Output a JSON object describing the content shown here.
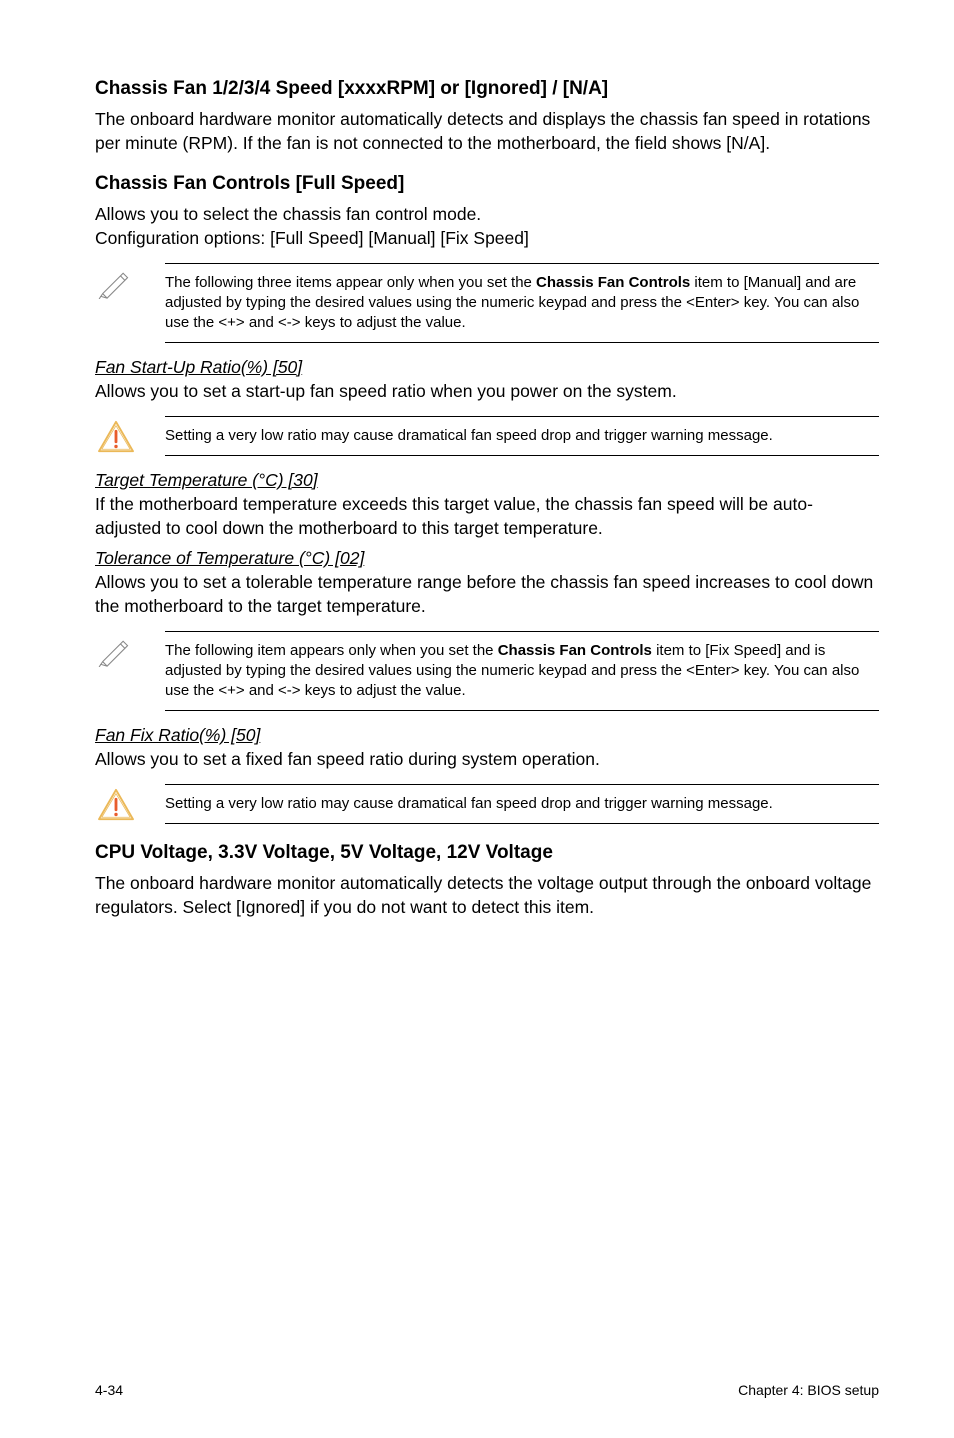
{
  "section1": {
    "heading": "Chassis Fan 1/2/3/4 Speed [xxxxRPM] or [Ignored] / [N/A]",
    "body": "The onboard hardware monitor automatically detects and displays the chassis fan speed in rotations per minute (RPM). If the fan is not connected to the motherboard, the field shows [N/A]."
  },
  "section2": {
    "heading": "Chassis Fan Controls [Full Speed]",
    "body_line1": "Allows you to select the chassis fan control mode.",
    "body_line2": "Configuration options: [Full Speed] [Manual] [Fix Speed]"
  },
  "callout1": {
    "prefix": "The following three items appear only when you set the ",
    "bold": "Chassis Fan Controls",
    "suffix": " item to [Manual] and are adjusted by typing the desired values using the numeric keypad and press the <Enter> key. You can also use the <+> and <-> keys to adjust the value."
  },
  "sub1": {
    "heading": "Fan Start-Up Ratio(%) [50]",
    "body": "Allows you to set a start-up fan speed ratio when you power on the system."
  },
  "callout2": {
    "text": "Setting a very low ratio may cause dramatical fan speed drop and trigger warning message."
  },
  "sub2": {
    "heading": "Target Temperature (°C) [30]",
    "body": "If the motherboard temperature exceeds this target value, the chassis fan speed will be auto-adjusted to cool down the motherboard to this target temperature."
  },
  "sub3": {
    "heading": "Tolerance of Temperature (°C) [02]",
    "body": "Allows you to set a tolerable temperature range before the chassis fan speed increases to cool down the motherboard to the target temperature."
  },
  "callout3": {
    "prefix": "The following item appears only when you set the ",
    "bold": "Chassis Fan Controls",
    "suffix": " item to [Fix Speed] and is adjusted by typing the desired values using the numeric keypad and press the <Enter> key. You can also use the <+> and <-> keys to adjust the value."
  },
  "sub4": {
    "heading": "Fan Fix Ratio(%) [50]",
    "body": "Allows you to set a fixed fan speed ratio during system operation."
  },
  "callout4": {
    "text": "Setting a very low ratio may cause dramatical fan speed drop and trigger warning message."
  },
  "section3": {
    "heading": "CPU Voltage, 3.3V Voltage, 5V Voltage, 12V Voltage",
    "body": "The onboard hardware monitor automatically detects the voltage output through the onboard voltage regulators. Select [Ignored] if you do not want to detect this item."
  },
  "footer": {
    "left": "4-34",
    "right": "Chapter 4: BIOS setup"
  }
}
